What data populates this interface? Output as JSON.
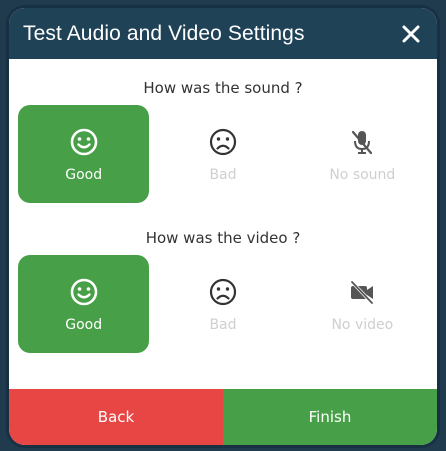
{
  "dialog": {
    "title": "Test Audio and Video Settings"
  },
  "sound": {
    "question": "How was the sound ?",
    "options": [
      {
        "label": "Good",
        "icon": "smile-icon",
        "selected": true
      },
      {
        "label": "Bad",
        "icon": "sad-icon",
        "selected": false
      },
      {
        "label": "No sound",
        "icon": "mic-off-icon",
        "selected": false
      }
    ]
  },
  "video": {
    "question": "How was the video ?",
    "options": [
      {
        "label": "Good",
        "icon": "smile-icon",
        "selected": true
      },
      {
        "label": "Bad",
        "icon": "sad-icon",
        "selected": false
      },
      {
        "label": "No video",
        "icon": "video-off-icon",
        "selected": false
      }
    ]
  },
  "footer": {
    "back_label": "Back",
    "finish_label": "Finish"
  },
  "colors": {
    "header": "#1f4257",
    "selected": "#47a047",
    "back": "#e84545",
    "finish": "#47a047",
    "inactive": "#cfcfcf"
  }
}
